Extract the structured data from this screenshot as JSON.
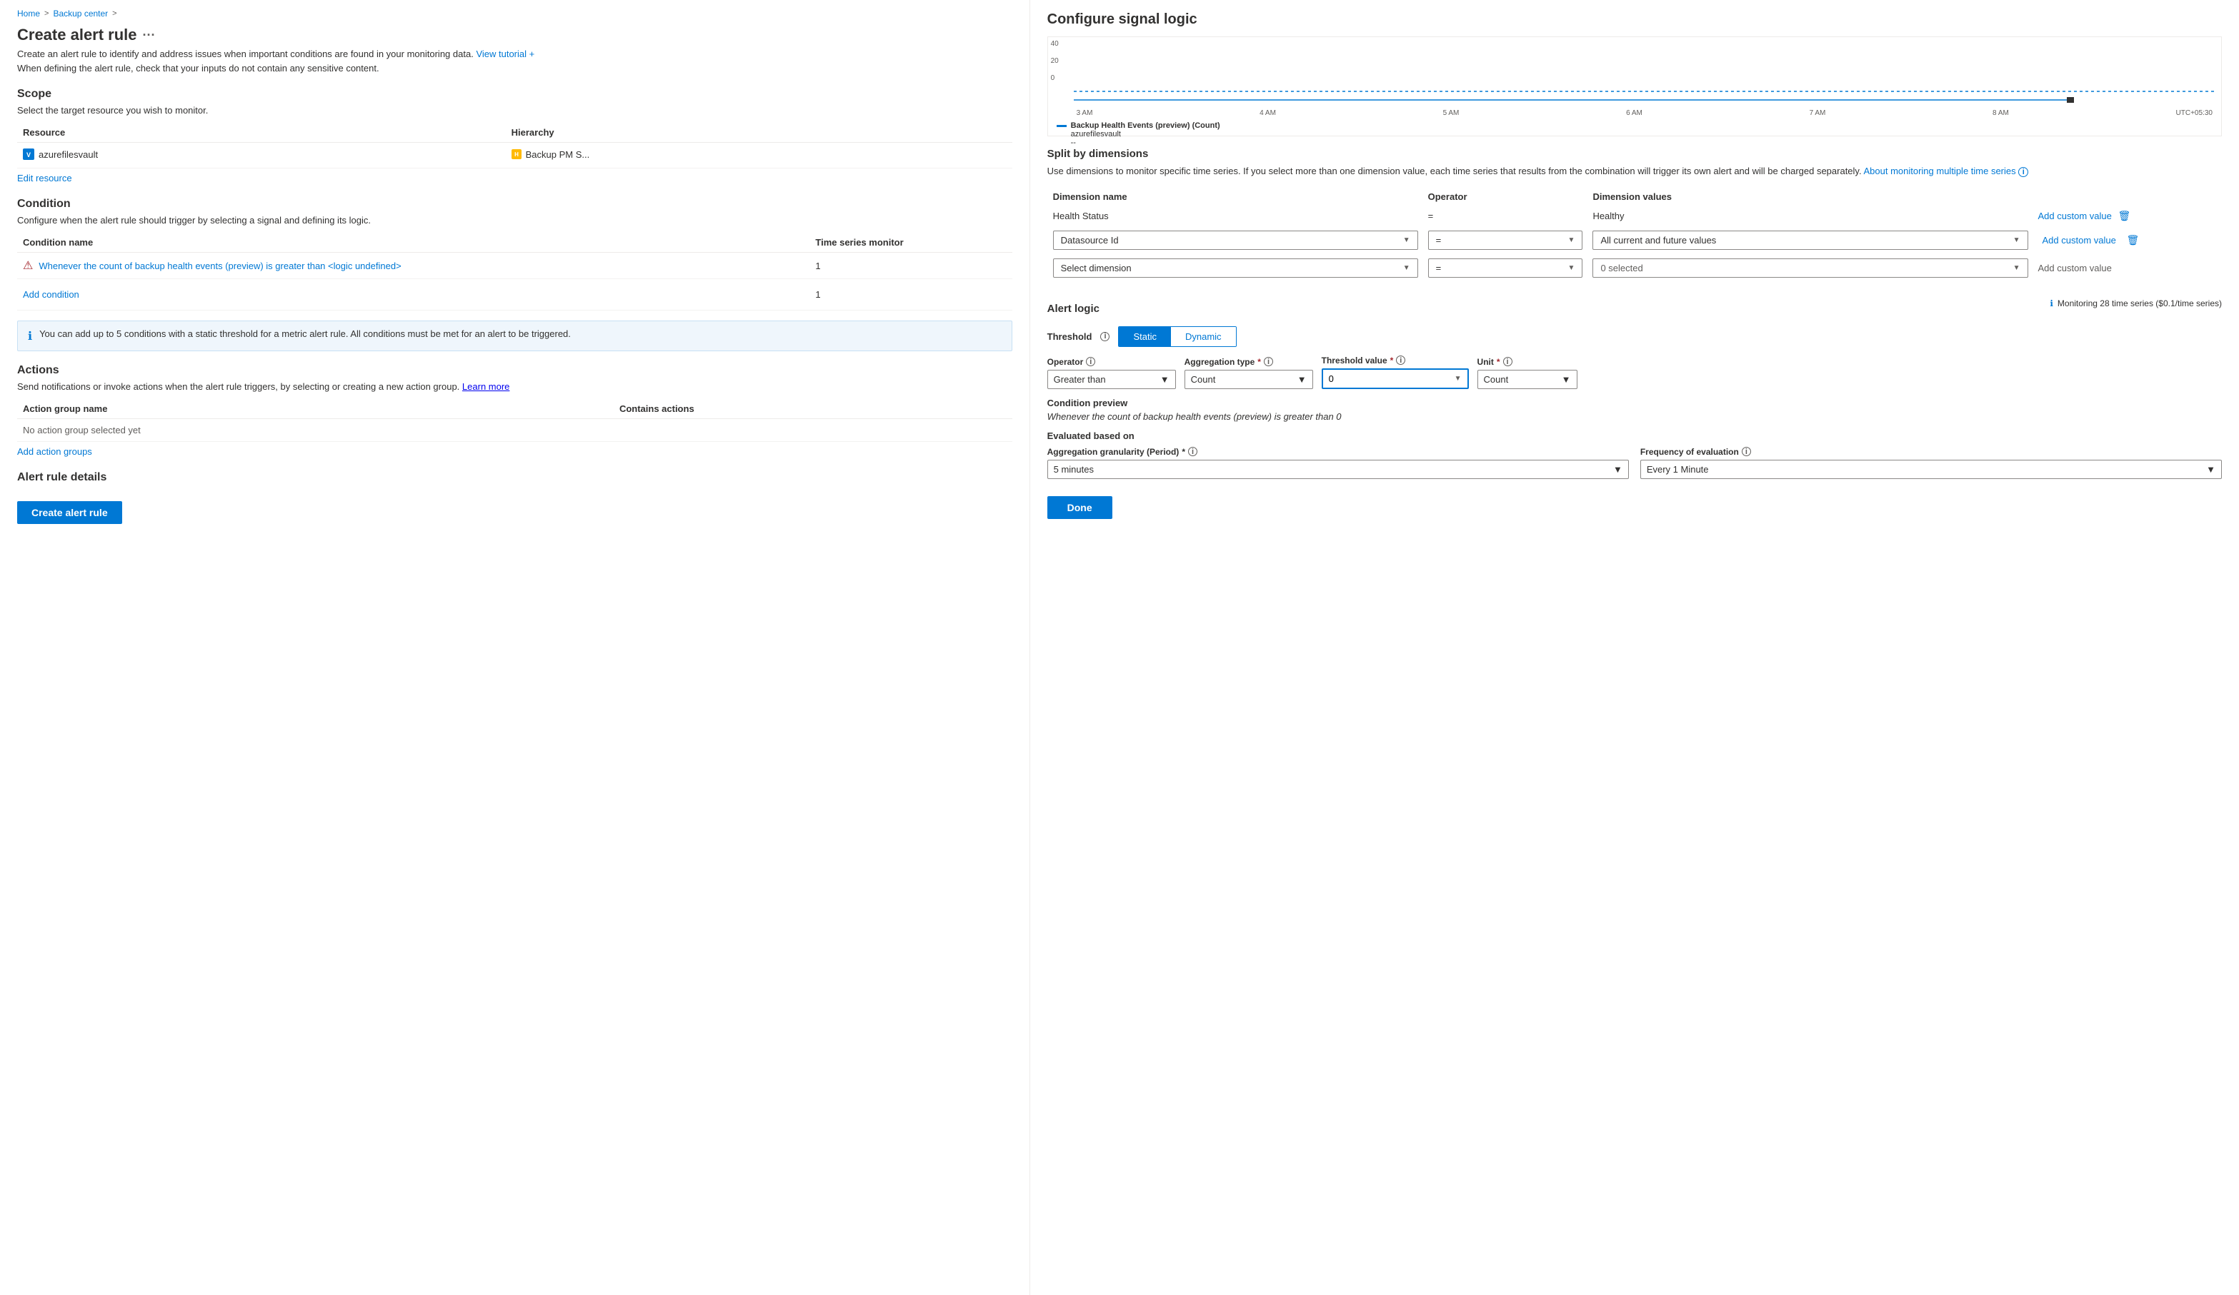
{
  "breadcrumb": {
    "home": "Home",
    "separator1": ">",
    "backupCenter": "Backup center",
    "separator2": ">"
  },
  "leftPanel": {
    "pageTitle": "Create alert rule",
    "ellipsis": "···",
    "description": "Create an alert rule to identify and address issues when important conditions are found in your monitoring data.",
    "viewTutorial": "View tutorial +",
    "sensitiveNote": "When defining the alert rule, check that your inputs do not contain any sensitive content.",
    "scope": {
      "title": "Scope",
      "desc": "Select the target resource you wish to monitor.",
      "table": {
        "headers": [
          "Resource",
          "Hierarchy"
        ],
        "rows": [
          {
            "icon": "vault-icon",
            "name": "azurefilesvault",
            "hierarchy": "Backup PM S..."
          }
        ]
      },
      "editLink": "Edit resource"
    },
    "condition": {
      "title": "Condition",
      "desc": "Configure when the alert rule should trigger by selecting a signal and defining its logic.",
      "tableHeaders": [
        "Condition name",
        "Time series monitor"
      ],
      "conditionLink": "Whenever the count of backup health events (preview) is greater than <logic undefined>",
      "conditionCount": "1",
      "addCondition": "Add condition",
      "addConditionCount": "1",
      "infoBanner": "You can add up to 5 conditions with a static threshold for a metric alert rule. All conditions must be met for an alert to be triggered."
    },
    "actions": {
      "title": "Actions",
      "desc": "Send notifications or invoke actions when the alert rule triggers, by selecting or creating a new action group.",
      "learnMore": "Learn more",
      "tableHeaders": [
        "Action group name",
        "Contains actions"
      ],
      "noGroup": "No action group selected yet",
      "addLink": "Add action groups"
    },
    "alertDetails": {
      "title": "Alert rule details"
    },
    "createButton": "Create alert rule"
  },
  "rightPanel": {
    "title": "Configure signal logic",
    "chart": {
      "yLabels": [
        "40",
        "20",
        "0"
      ],
      "xLabels": [
        "3 AM",
        "4 AM",
        "5 AM",
        "6 AM",
        "7 AM",
        "8 AM",
        "UTC+05:30"
      ],
      "legendTitle": "Backup Health Events (preview) (Count)",
      "legendSub": "azurefilesvault",
      "legendValue": "--"
    },
    "splitByDimensions": {
      "title": "Split by dimensions",
      "desc": "Use dimensions to monitor specific time series. If you select more than one dimension value, each time series that results from the combination will trigger its own alert and will be charged separately.",
      "aboutLink": "About monitoring multiple time series",
      "tableHeaders": [
        "Dimension name",
        "Operator",
        "Dimension values"
      ],
      "staticRow": {
        "name": "Health Status",
        "operator": "=",
        "value": "Healthy",
        "customValue": "Add custom value"
      },
      "row1": {
        "nameDropdown": "Datasource Id",
        "operator": "=",
        "valueDropdown": "All current and future values",
        "customValue": "Add custom value"
      },
      "row2": {
        "nameDropdown": "Select dimension",
        "operator": "=",
        "valueDropdown": "0 selected",
        "customValue": "Add custom value"
      }
    },
    "alertLogic": {
      "title": "Alert logic",
      "thresholdLabel": "Threshold",
      "thresholdInfo": "i",
      "toggleStatic": "Static",
      "toggleDynamic": "Dynamic",
      "monitoringInfo": "Monitoring 28 time series ($0.1/time series)",
      "operatorLabel": "Operator",
      "operatorInfo": "i",
      "operatorValue": "Greater than",
      "aggTypeLabel": "Aggregation type",
      "aggTypeRequired": "*",
      "aggTypeInfo": "i",
      "aggTypeValue": "Count",
      "thresholdValueLabel": "Threshold value",
      "thresholdValueRequired": "*",
      "thresholdValueInfo": "i",
      "thresholdValue": "0",
      "unitLabel": "Unit",
      "unitRequired": "*",
      "unitInfo": "i",
      "unitValue": "Count",
      "conditionPreviewTitle": "Condition preview",
      "conditionPreviewText": "Whenever the count of backup health events (preview) is greater than 0",
      "evaluatedTitle": "Evaluated based on",
      "aggGranularityLabel": "Aggregation granularity (Period)",
      "aggGranularityRequired": "*",
      "aggGranularityInfo": "i",
      "aggGranularityValue": "5 minutes",
      "freqLabel": "Frequency of evaluation",
      "freqInfo": "i",
      "freqValue": "Every 1 Minute"
    },
    "doneButton": "Done"
  }
}
